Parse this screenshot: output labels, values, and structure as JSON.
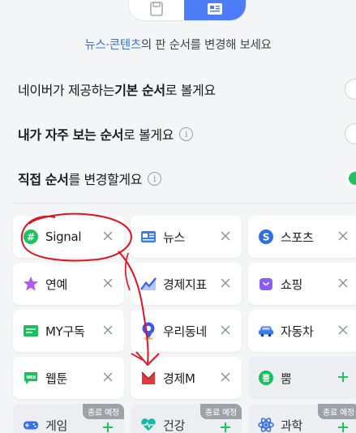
{
  "headline": {
    "highlight": "뉴스·콘텐츠",
    "rest": "의 판 순서를 변경해 보세요"
  },
  "options": [
    {
      "prefix": "네이버가 제공하는 ",
      "bold": "기본 순서",
      "suffix": "로 볼게요",
      "info": false,
      "selected": false
    },
    {
      "prefix": "",
      "bold": "내가 자주 보는 순서",
      "suffix": "로 볼게요",
      "info": true,
      "selected": false
    },
    {
      "prefix": "",
      "bold": "직접 순서",
      "suffix": "를 변경할게요",
      "info": true,
      "selected": true
    }
  ],
  "tiles": [
    {
      "label": "Signal",
      "icon": "signal-icon",
      "state": "active"
    },
    {
      "label": "뉴스",
      "icon": "news-icon",
      "state": "active"
    },
    {
      "label": "스포츠",
      "icon": "sports-icon",
      "state": "active"
    },
    {
      "label": "연예",
      "icon": "entertainment-star-icon",
      "state": "active"
    },
    {
      "label": "경제지표",
      "icon": "economy-chart-icon",
      "state": "active"
    },
    {
      "label": "쇼핑",
      "icon": "shopping-bag-icon",
      "state": "active"
    },
    {
      "label": "MY구독",
      "icon": "subscription-icon",
      "state": "active"
    },
    {
      "label": "우리동네",
      "icon": "neighborhood-pin-icon",
      "state": "active"
    },
    {
      "label": "자동차",
      "icon": "car-icon",
      "state": "active"
    },
    {
      "label": "웹툰",
      "icon": "webtoon-icon",
      "state": "active"
    },
    {
      "label": "경제M",
      "icon": "economy-m-icon",
      "state": "active"
    },
    {
      "label": "뿜",
      "icon": "bbum-icon",
      "state": "inactive"
    },
    {
      "label": "게임",
      "icon": "game-controller-icon",
      "state": "inactive",
      "badge": "종료 예정"
    },
    {
      "label": "건강",
      "icon": "health-heart-icon",
      "state": "inactive",
      "badge": "종료 예정"
    },
    {
      "label": "과학",
      "icon": "science-icon",
      "state": "inactive",
      "badge": "종료 예정"
    }
  ],
  "colors": {
    "accent": "#4d7df6",
    "highlight_text": "#3a72d6",
    "selected_radio": "#1ec25f",
    "annotation": "#e0141e"
  }
}
